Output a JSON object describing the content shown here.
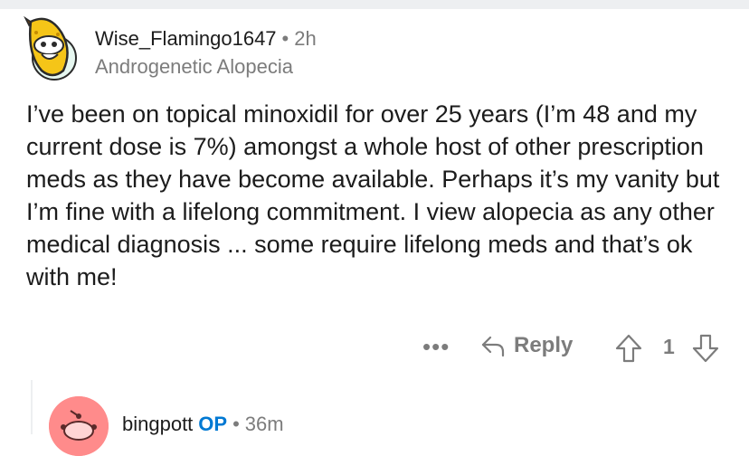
{
  "comment": {
    "username": "Wise_Flamingo1647",
    "separator": "•",
    "time": "2h",
    "flair": "Androgenetic Alopecia",
    "body": "I’ve been on topical minoxidil for over 25 years (I’m 48 and my current dose is 7%) amongst a whole host of other prescription meds as they have become available. Perhaps it’s my vanity but I’m fine with a lifelong commitment. I view alopecia as any other medical diagnosis ... some require lifelong meds and that’s ok with me!",
    "actions": {
      "more_label": "•••",
      "reply_label": "Reply",
      "score": "1"
    }
  },
  "child_comment": {
    "username": "bingpott",
    "op_badge": "OP",
    "separator": "•",
    "time": "36m"
  },
  "colors": {
    "meta_gray": "#7c7c7c",
    "op_blue": "#0079d3",
    "avatar_yellow": "#f5c518",
    "child_avatar_pink": "#ff8b8b"
  },
  "icons": {
    "avatar": "snoo-banana-avatar",
    "more": "more-options-icon",
    "reply": "reply-arrow-icon",
    "upvote": "upvote-arrow-icon",
    "downvote": "downvote-arrow-icon"
  }
}
